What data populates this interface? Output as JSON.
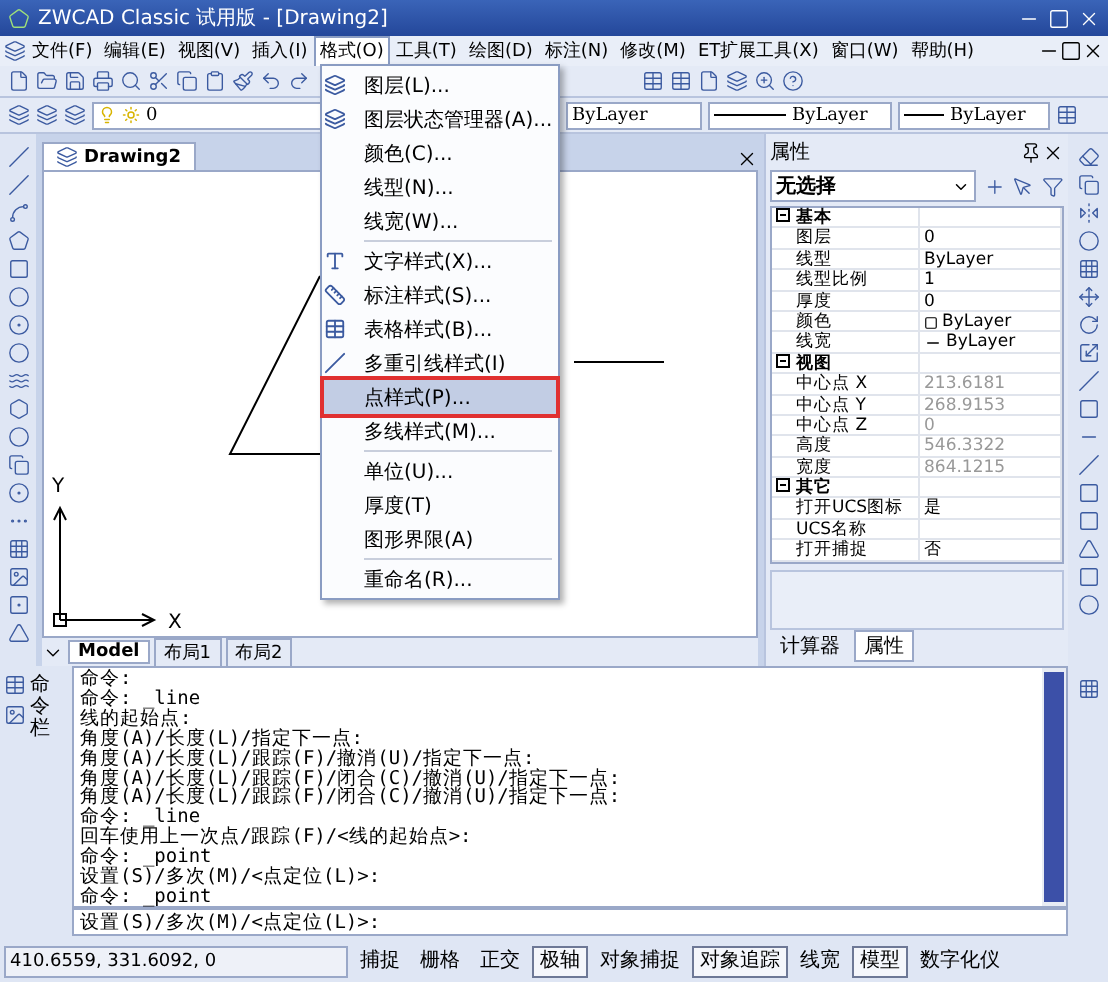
{
  "window": {
    "title": "ZWCAD Classic 试用版 - [Drawing2]"
  },
  "menu_bar": [
    {
      "label": "文件(F)",
      "selected": false
    },
    {
      "label": "编辑(E)",
      "selected": false
    },
    {
      "label": "视图(V)",
      "selected": false
    },
    {
      "label": "插入(I)",
      "selected": false
    },
    {
      "label": "格式(O)",
      "selected": true
    },
    {
      "label": "工具(T)",
      "selected": false
    },
    {
      "label": "绘图(D)",
      "selected": false
    },
    {
      "label": "标注(N)",
      "selected": false
    },
    {
      "label": "修改(M)",
      "selected": false
    },
    {
      "label": "ET扩展工具(X)",
      "selected": false
    },
    {
      "label": "窗口(W)",
      "selected": false
    },
    {
      "label": "帮助(H)",
      "selected": false
    }
  ],
  "format_menu": {
    "groups": [
      {
        "items": [
          {
            "label": "图层(L)...",
            "selected": false
          },
          {
            "label": "图层状态管理器(A)...",
            "selected": false
          },
          {
            "label": "颜色(C)...",
            "selected": false
          },
          {
            "label": "线型(N)...",
            "selected": false
          },
          {
            "label": "线宽(W)...",
            "selected": false
          }
        ]
      },
      {
        "items": [
          {
            "label": "文字样式(X)...",
            "selected": false
          },
          {
            "label": "标注样式(S)...",
            "selected": false
          },
          {
            "label": "表格样式(B)...",
            "selected": false
          },
          {
            "label": "多重引线样式(I)",
            "selected": false
          },
          {
            "label": "点样式(P)...",
            "selected": true
          },
          {
            "label": "多线样式(M)...",
            "selected": false
          }
        ]
      },
      {
        "items": [
          {
            "label": "单位(U)...",
            "selected": false
          },
          {
            "label": "厚度(T)",
            "selected": false
          },
          {
            "label": "图形界限(A)",
            "selected": false
          }
        ]
      },
      {
        "items": [
          {
            "label": "重命名(R)...",
            "selected": false
          }
        ]
      }
    ]
  },
  "layer_toolbar": {
    "layer": "0",
    "color_setting": "ByLayer",
    "linetype": "ByLayer",
    "lineweight": "ByLayer"
  },
  "document_tab": {
    "title": "Drawing2"
  },
  "layout_tabs": [
    {
      "label": "Model",
      "selected": true
    },
    {
      "label": "布局1",
      "selected": false
    },
    {
      "label": "布局2",
      "selected": false
    }
  ],
  "axis_labels": {
    "x": "X",
    "y": "Y"
  },
  "properties_panel": {
    "title": "属性",
    "selection": "无选择",
    "groups": [
      {
        "name": "基本",
        "expanded": true,
        "rows": [
          {
            "label": "图层",
            "value": "0",
            "kind": "text",
            "disabled": false
          },
          {
            "label": "线型",
            "value": "ByLayer",
            "kind": "text",
            "disabled": false
          },
          {
            "label": "线型比例",
            "value": "1",
            "kind": "text",
            "disabled": false
          },
          {
            "label": "厚度",
            "value": "0",
            "kind": "text",
            "disabled": false
          },
          {
            "label": "颜色",
            "value": "ByLayer",
            "kind": "color",
            "disabled": false
          },
          {
            "label": "线宽",
            "value": "ByLayer",
            "kind": "lineweight",
            "disabled": false
          }
        ]
      },
      {
        "name": "视图",
        "expanded": true,
        "rows": [
          {
            "label": "中心点 X",
            "value": "213.6181",
            "kind": "text",
            "disabled": true
          },
          {
            "label": "中心点 Y",
            "value": "268.9153",
            "kind": "text",
            "disabled": true
          },
          {
            "label": "中心点 Z",
            "value": "0",
            "kind": "text",
            "disabled": true
          },
          {
            "label": "高度",
            "value": "546.3322",
            "kind": "text",
            "disabled": true
          },
          {
            "label": "宽度",
            "value": "864.1215",
            "kind": "text",
            "disabled": true
          }
        ]
      },
      {
        "name": "其它",
        "expanded": true,
        "rows": [
          {
            "label": "打开UCS图标",
            "value": "是",
            "kind": "text",
            "disabled": false
          },
          {
            "label": "UCS名称",
            "value": "",
            "kind": "text",
            "disabled": false
          },
          {
            "label": "打开捕捉",
            "value": "否",
            "kind": "text",
            "disabled": false
          }
        ]
      }
    ],
    "tabs": [
      {
        "label": "计算器",
        "selected": false
      },
      {
        "label": "属性",
        "selected": true
      }
    ]
  },
  "command_window": {
    "label": "命令栏",
    "history": [
      "命令:",
      "命令: _line",
      "线的起始点:",
      "角度(A)/长度(L)/指定下一点:",
      "角度(A)/长度(L)/跟踪(F)/撤消(U)/指定下一点:",
      "角度(A)/长度(L)/跟踪(F)/闭合(C)/撤消(U)/指定下一点:",
      "角度(A)/长度(L)/跟踪(F)/闭合(C)/撤消(U)/指定下一点:",
      "命令: _line",
      "回车使用上一次点/跟踪(F)/<线的起始点>:",
      "命令: _point",
      "设置(S)/多次(M)/<点定位(L)>:",
      "命令: _point"
    ],
    "prompt": "设置(S)/多次(M)/<点定位(L)>:"
  },
  "status_bar": {
    "coordinates": "410.6559, 331.6092, 0",
    "toggles": [
      {
        "label": "捕捉",
        "on": false
      },
      {
        "label": "栅格",
        "on": false
      },
      {
        "label": "正交",
        "on": false
      },
      {
        "label": "极轴",
        "on": true
      },
      {
        "label": "对象捕捉",
        "on": false
      },
      {
        "label": "对象追踪",
        "on": true
      },
      {
        "label": "线宽",
        "on": false
      },
      {
        "label": "模型",
        "on": true
      },
      {
        "label": "数字化仪",
        "on": false
      }
    ]
  }
}
